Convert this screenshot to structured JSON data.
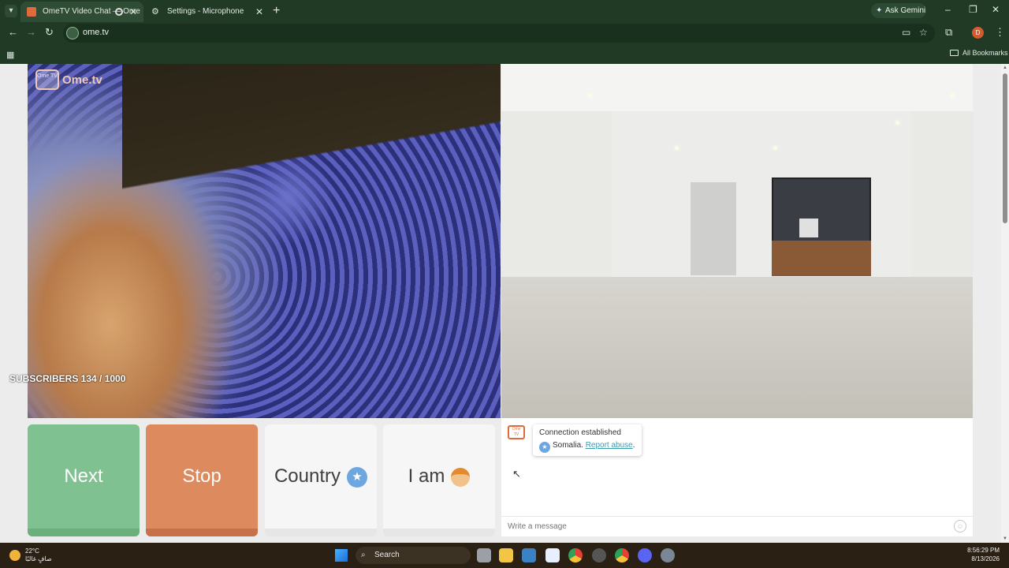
{
  "browser": {
    "tabs": [
      {
        "title": "OmeTV Video Chat — Ome",
        "active": true
      },
      {
        "title": "Settings - Microphone",
        "active": false
      }
    ],
    "ask_gemini": "Ask Gemini",
    "url": "ome.tv",
    "profile_initial": "D",
    "all_bookmarks": "All Bookmarks"
  },
  "ometv": {
    "logo_text": "Ome.tv",
    "logo_badge": "Ome TV",
    "subscribers": "SUBSCRIBERS 134 / 1000",
    "buttons": {
      "next": "Next",
      "stop": "Stop",
      "country": "Country",
      "i_am": "I am"
    },
    "chat": {
      "status": "Connection established",
      "country": "Somalia.",
      "report": "Report abuse",
      "report_suffix": ".",
      "placeholder": "Write a message"
    }
  },
  "colors": {
    "next": "#7fc190",
    "stop": "#dd8a5e",
    "badge": "#6ea6df",
    "browser_frame": "#213a26"
  },
  "taskbar": {
    "weather_temp": "22°C",
    "weather_desc": "صافٍ غالبًا",
    "search": "Search",
    "time": "8:56:29 PM",
    "date": "8/13/2026"
  }
}
